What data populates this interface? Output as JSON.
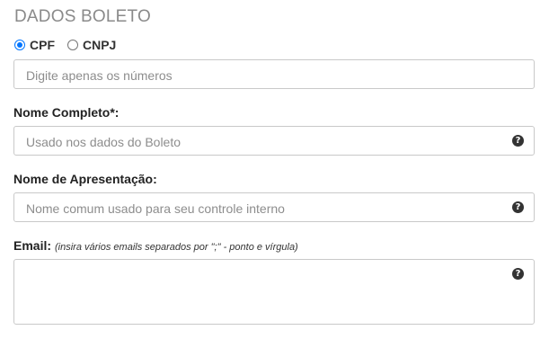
{
  "section": {
    "title": "DADOS BOLETO"
  },
  "person_type": {
    "options": [
      {
        "label": "CPF",
        "selected": true
      },
      {
        "label": "CNPJ",
        "selected": false
      }
    ]
  },
  "document": {
    "placeholder": "Digite apenas os números"
  },
  "full_name": {
    "label": "Nome Completo*:",
    "placeholder": "Usado nos dados do Boleto",
    "help_icon": "question-circle-icon"
  },
  "display_name": {
    "label": "Nome de Apresentação:",
    "placeholder": "Nome comum usado para seu controle interno",
    "help_icon": "question-circle-icon"
  },
  "email": {
    "label": "Email:",
    "hint": "(insira vários emails separados por \";\" - ponto e vírgula)",
    "help_icon": "question-circle-icon"
  },
  "help_glyph": "?",
  "colors": {
    "radio_accent": "#0075ff",
    "title_gray": "#8a8a8a",
    "border": "#c9c9c9"
  }
}
